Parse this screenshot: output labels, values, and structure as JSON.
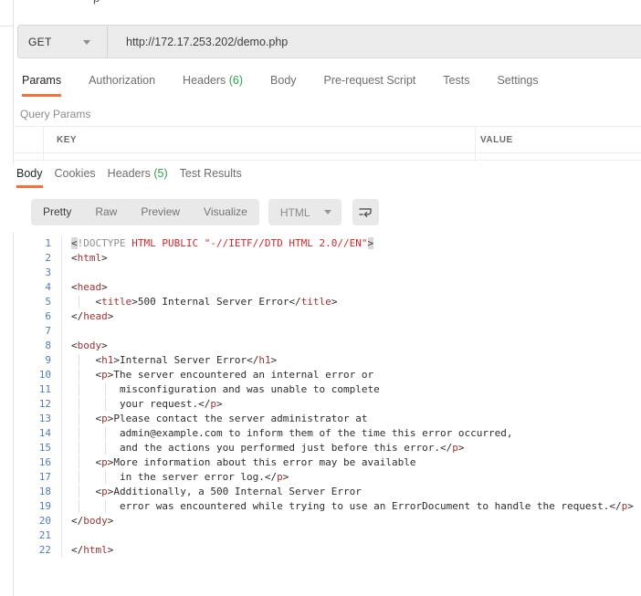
{
  "misc": {
    "clipped_fragment": "p"
  },
  "colors": {
    "accent_orange": "#ff6c37",
    "count_green": "#2aa052",
    "tag_maroon": "#9a3334",
    "doctype_red": "#cb2a2a",
    "meta_gray": "#8f8f8f",
    "line_number_blue": "#4d7fb2",
    "bar_gray": "#ebebeb"
  },
  "request": {
    "method": "GET",
    "url": "http://172.17.253.202/demo.php",
    "tabs": [
      {
        "label": "Params",
        "active": true
      },
      {
        "label": "Authorization"
      },
      {
        "label": "Headers",
        "count": "(6)"
      },
      {
        "label": "Body"
      },
      {
        "label": "Pre-request Script"
      },
      {
        "label": "Tests"
      },
      {
        "label": "Settings"
      }
    ],
    "query_params_label": "Query Params",
    "params_table": {
      "columns": [
        "KEY",
        "VALUE"
      ]
    }
  },
  "response": {
    "tabs": [
      {
        "label": "Body",
        "active": true
      },
      {
        "label": "Cookies"
      },
      {
        "label": "Headers",
        "count": "(5)"
      },
      {
        "label": "Test Results"
      }
    ],
    "toolbar": {
      "views": [
        {
          "label": "Pretty",
          "active": true
        },
        {
          "label": "Raw"
        },
        {
          "label": "Preview"
        },
        {
          "label": "Visualize"
        }
      ],
      "format": "HTML"
    },
    "body_code": {
      "lines": [
        {
          "n": 1,
          "g": 0,
          "s": [
            [
              "h",
              "<"
            ],
            [
              "m",
              "!DOCTYPE"
            ],
            [
              "r",
              " HTML PUBLIC \"-//IETF//DTD HTML 2.0//EN\""
            ],
            [
              "h",
              ">"
            ]
          ]
        },
        {
          "n": 2,
          "g": 0,
          "s": [
            [
              "b",
              "<"
            ],
            [
              "t",
              "html"
            ],
            [
              "b",
              ">"
            ]
          ]
        },
        {
          "n": 3,
          "g": 0,
          "s": []
        },
        {
          "n": 4,
          "g": 0,
          "s": [
            [
              "b",
              "<"
            ],
            [
              "t",
              "head"
            ],
            [
              "b",
              ">"
            ]
          ]
        },
        {
          "n": 5,
          "g": 1,
          "s": [
            [
              "b",
              "    <"
            ],
            [
              "t",
              "title"
            ],
            [
              "b",
              ">500 Internal Server Error</"
            ],
            [
              "t",
              "title"
            ],
            [
              "b",
              ">"
            ]
          ]
        },
        {
          "n": 6,
          "g": 0,
          "s": [
            [
              "b",
              "</"
            ],
            [
              "t",
              "head"
            ],
            [
              "b",
              ">"
            ]
          ]
        },
        {
          "n": 7,
          "g": 0,
          "s": []
        },
        {
          "n": 8,
          "g": 0,
          "s": [
            [
              "b",
              "<"
            ],
            [
              "t",
              "body"
            ],
            [
              "b",
              ">"
            ]
          ]
        },
        {
          "n": 9,
          "g": 1,
          "s": [
            [
              "b",
              "    <"
            ],
            [
              "t",
              "h1"
            ],
            [
              "b",
              ">Internal Server Error</"
            ],
            [
              "t",
              "h1"
            ],
            [
              "b",
              ">"
            ]
          ]
        },
        {
          "n": 10,
          "g": 1,
          "s": [
            [
              "b",
              "    <"
            ],
            [
              "t",
              "p"
            ],
            [
              "b",
              ">The server encountered an internal error or"
            ]
          ]
        },
        {
          "n": 11,
          "g": 2,
          "s": [
            [
              "b",
              "        misconfiguration and was unable to complete"
            ]
          ]
        },
        {
          "n": 12,
          "g": 2,
          "s": [
            [
              "b",
              "        your request.</"
            ],
            [
              "t",
              "p"
            ],
            [
              "b",
              ">"
            ]
          ]
        },
        {
          "n": 13,
          "g": 1,
          "s": [
            [
              "b",
              "    <"
            ],
            [
              "t",
              "p"
            ],
            [
              "b",
              ">Please contact the server administrator at"
            ]
          ]
        },
        {
          "n": 14,
          "g": 2,
          "s": [
            [
              "b",
              "        admin@example.com to inform them of the time this error occurred,"
            ]
          ]
        },
        {
          "n": 15,
          "g": 2,
          "s": [
            [
              "b",
              "        and the actions you performed just before this error.</"
            ],
            [
              "t",
              "p"
            ],
            [
              "b",
              ">"
            ]
          ]
        },
        {
          "n": 16,
          "g": 1,
          "s": [
            [
              "b",
              "    <"
            ],
            [
              "t",
              "p"
            ],
            [
              "b",
              ">More information about this error may be available"
            ]
          ]
        },
        {
          "n": 17,
          "g": 2,
          "s": [
            [
              "b",
              "        in the server error log.</"
            ],
            [
              "t",
              "p"
            ],
            [
              "b",
              ">"
            ]
          ]
        },
        {
          "n": 18,
          "g": 1,
          "s": [
            [
              "b",
              "    <"
            ],
            [
              "t",
              "p"
            ],
            [
              "b",
              ">Additionally, a 500 Internal Server Error"
            ]
          ]
        },
        {
          "n": 19,
          "g": 2,
          "s": [
            [
              "b",
              "        error was encountered while trying to use an ErrorDocument to handle the request.</"
            ],
            [
              "t",
              "p"
            ],
            [
              "b",
              ">"
            ]
          ]
        },
        {
          "n": 20,
          "g": 0,
          "s": [
            [
              "b",
              "</"
            ],
            [
              "t",
              "body"
            ],
            [
              "b",
              ">"
            ]
          ]
        },
        {
          "n": 21,
          "g": 0,
          "s": []
        },
        {
          "n": 22,
          "g": 0,
          "s": [
            [
              "b",
              "</"
            ],
            [
              "t",
              "html"
            ],
            [
              "b",
              ">"
            ]
          ]
        }
      ]
    }
  }
}
